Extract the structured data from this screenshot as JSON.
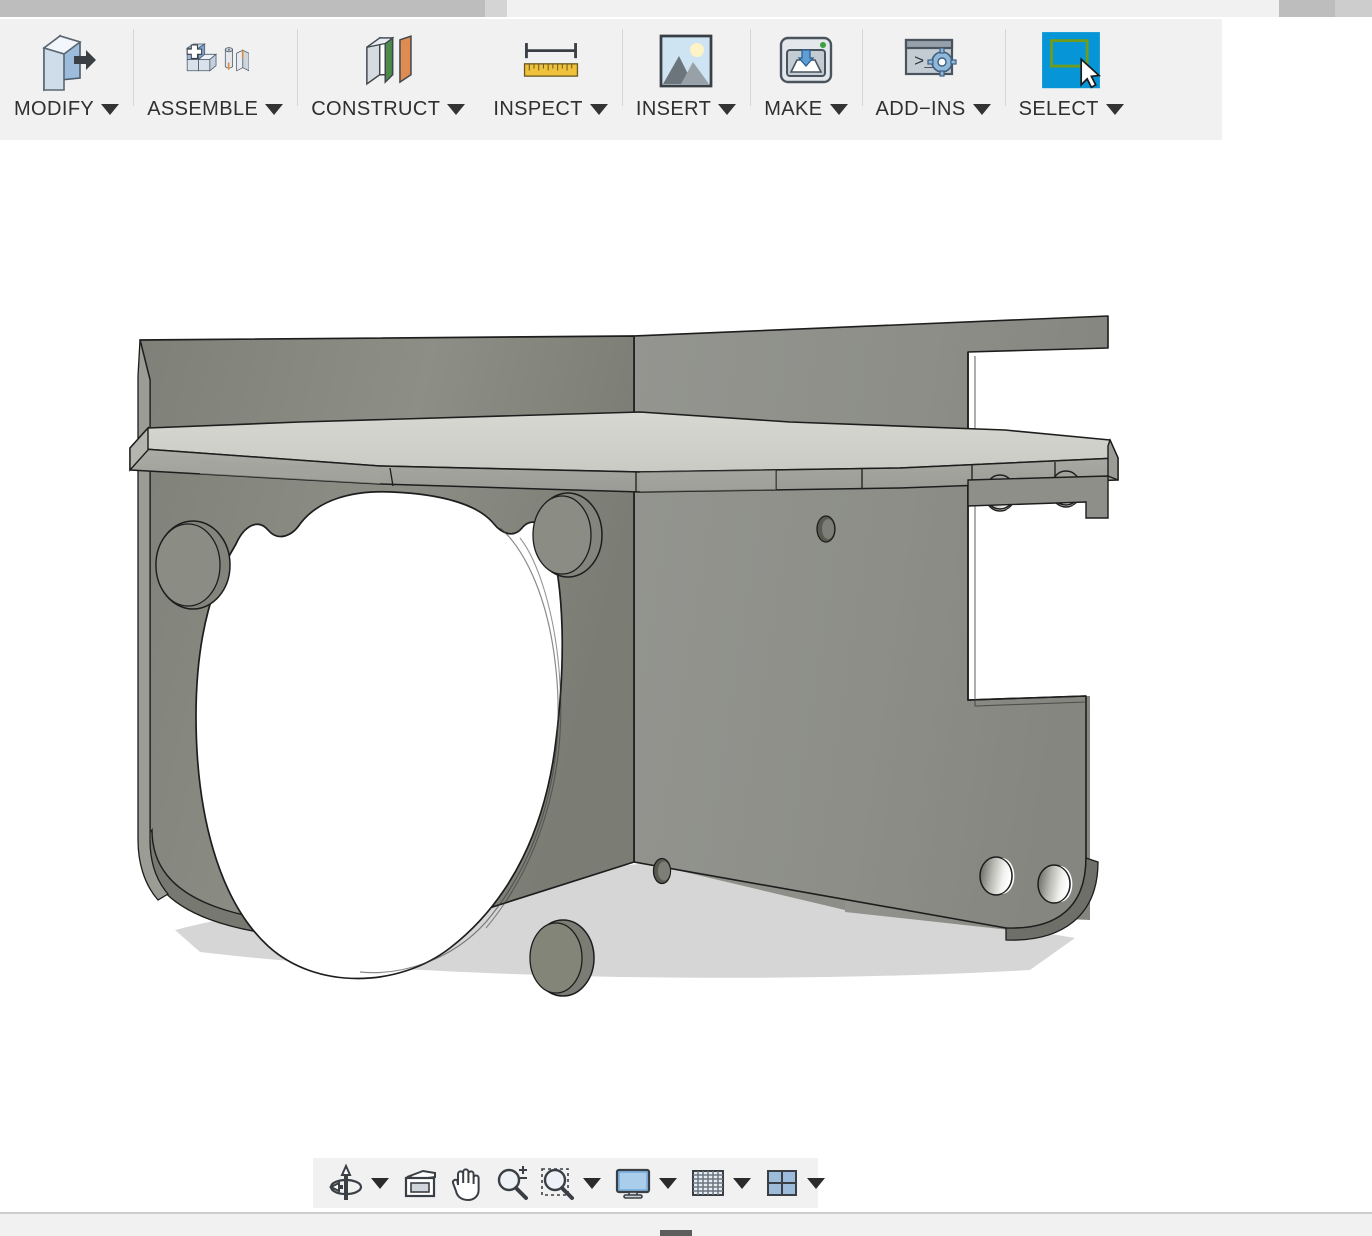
{
  "app": {
    "kind": "cad-3d-modeler",
    "viewport_background": "#ffffff"
  },
  "colors": {
    "toolbar_bg": "#f1f1f1",
    "separator": "#d6d6d6",
    "label_text": "#2f2f2f",
    "select_tile_blue": "#0696d7",
    "select_rect_green": "#6f9b1f",
    "model_face_light": "#cfd0cb",
    "model_face_mid": "#8a8b84",
    "model_face_dark": "#646560",
    "model_shadow": "#d3d3d3",
    "scrollbar_thumb": "#bdbdbd",
    "scrollbar_track": "#f1f1f1"
  },
  "top_scrollbar": {
    "name": "horizontal-scrollbar",
    "thumb_left_width": 485,
    "thumb_right_start": 1279
  },
  "ribbon": {
    "groups": [
      {
        "id": "modify",
        "label": "MODIFY",
        "icon": "modify-solid-arrow-icon",
        "has_caret": true
      },
      {
        "id": "assemble",
        "label": "ASSEMBLE",
        "icon": "assemble-blocks-plus-icon",
        "has_caret": true
      },
      {
        "id": "construct",
        "label": "CONSTRUCT",
        "icon": "construct-plane-icon",
        "has_caret": true
      },
      {
        "id": "inspect",
        "label": "INSPECT",
        "icon": "inspect-ruler-icon",
        "has_caret": true
      },
      {
        "id": "insert",
        "label": "INSERT",
        "icon": "insert-image-icon",
        "has_caret": true
      },
      {
        "id": "make",
        "label": "MAKE",
        "icon": "make-3d-print-icon",
        "has_caret": true
      },
      {
        "id": "addins",
        "label": "ADD−INS",
        "icon": "addins-script-gear-icon",
        "has_caret": true
      },
      {
        "id": "select",
        "label": "SELECT",
        "icon": "select-cursor-marquee-icon",
        "has_caret": true,
        "active": true
      }
    ]
  },
  "nav_bar": {
    "items": [
      {
        "id": "orbit",
        "label": "orbit-icon",
        "caret": true
      },
      {
        "id": "view-faces",
        "label": "look-at-icon",
        "caret": false
      },
      {
        "id": "pan",
        "label": "pan-hand-icon",
        "caret": false
      },
      {
        "id": "zoom",
        "label": "zoom-icon",
        "caret": false
      },
      {
        "id": "zoom-window",
        "label": "zoom-window-icon",
        "caret": true
      },
      {
        "id": "display",
        "label": "display-settings-icon",
        "caret": true
      },
      {
        "id": "grid",
        "label": "grid-settings-icon",
        "caret": true
      },
      {
        "id": "viewports",
        "label": "viewport-layout-icon",
        "caret": true
      }
    ]
  },
  "model": {
    "name": "l-shaped-bracket-part",
    "description": "Shaded L-shaped sheet-metal style bracket with large oval cutout, four counterbores on the left face, two small through holes and four large holes on the right face",
    "shadow_visible": true
  },
  "bottom_bar": {
    "handle_name": "window-resize-handle"
  }
}
